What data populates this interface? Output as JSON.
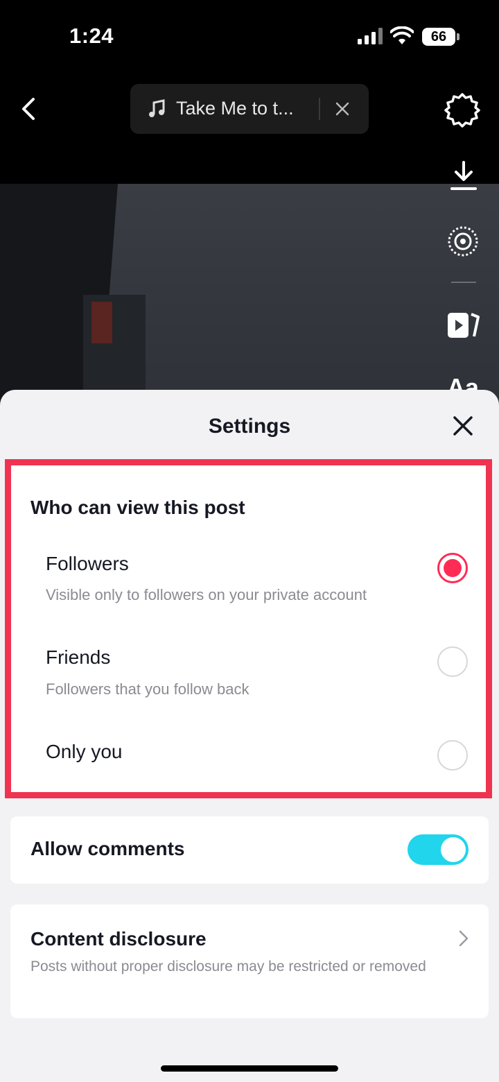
{
  "status_bar": {
    "time": "1:24",
    "battery": "66"
  },
  "top_bar": {
    "music_title": "Take Me to t..."
  },
  "side_tools": [
    {
      "icon": "download-icon"
    },
    {
      "icon": "voice-effect-icon"
    },
    {
      "icon": "template-clips-icon"
    },
    {
      "icon": "text-icon",
      "label": "Aa"
    }
  ],
  "sheet": {
    "title": "Settings",
    "who_can_view": {
      "title": "Who can view this post",
      "options": [
        {
          "label": "Followers",
          "description": "Visible only to followers on your private account",
          "selected": true
        },
        {
          "label": "Friends",
          "description": "Followers that you follow back",
          "selected": false
        },
        {
          "label": "Only you",
          "description": "",
          "selected": false
        }
      ]
    },
    "allow_comments": {
      "label": "Allow comments",
      "enabled": true
    },
    "content_disclosure": {
      "title": "Content disclosure",
      "description": "Posts without proper disclosure may be restricted or removed"
    }
  },
  "colors": {
    "highlight_border": "#ef3350",
    "radio_selected": "#fe2c55",
    "toggle_on": "#20d5ec",
    "sheet_background": "#f2f2f4"
  }
}
